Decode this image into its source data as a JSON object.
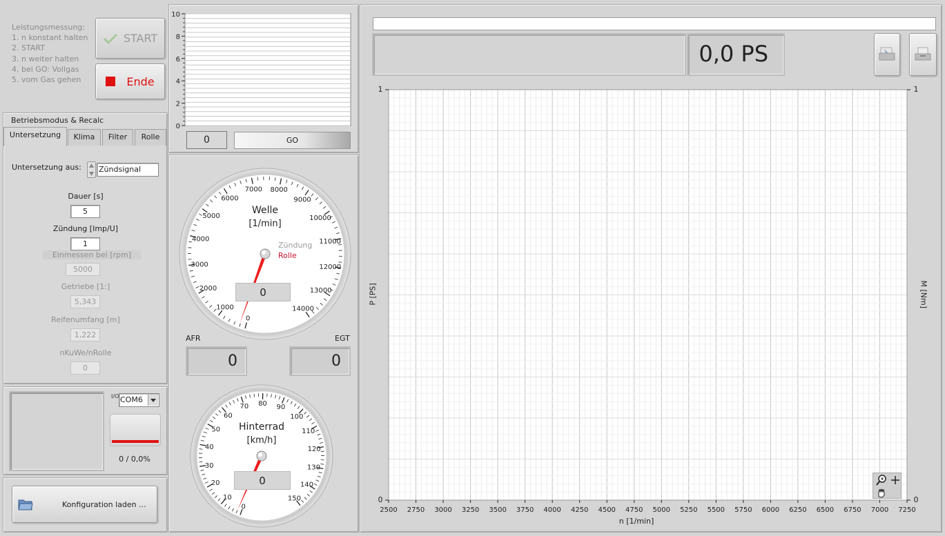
{
  "instructions": {
    "title": "Leistungsmessung:",
    "steps": [
      "1. n konstant halten",
      "2. START",
      "3. n weiter halten",
      "4. bei GO: Vollgas",
      "5. vom Gas gehen"
    ]
  },
  "buttons": {
    "start": "START",
    "ende": "Ende",
    "config": "Konfiguration laden ..."
  },
  "mini_chart": {
    "y_ticks": [
      "10",
      "8",
      "6",
      "4",
      "2",
      "0"
    ],
    "value": "0",
    "go_label": "GO"
  },
  "tabs_panel": {
    "title": "Betriebsmodus & Recalc",
    "tabs": [
      "Untersetzung",
      "Klima",
      "Filter",
      "Rolle"
    ],
    "active_tab": "Untersetzung",
    "untersetzung_label": "Untersetzung aus:",
    "untersetzung_value": "Zündsignal",
    "fields": [
      {
        "label": "Dauer [s]",
        "value": "5",
        "enabled": true
      },
      {
        "label": "Zündung [Imp/U]",
        "value": "1",
        "enabled": true
      },
      {
        "label": "Einmessen bei [rpm]",
        "value": "5000",
        "enabled": false
      },
      {
        "label": "Getriebe [1:]",
        "value": "5,343",
        "enabled": false
      },
      {
        "label": "Reifenumfang [m]",
        "value": "1,222",
        "enabled": false
      },
      {
        "label": "nKuWe/nRolle",
        "value": "0",
        "enabled": false
      }
    ]
  },
  "com": {
    "io_glyph": "I/O",
    "port": "COM6",
    "progress_text": "0 / 0,0%"
  },
  "gauge_welle": {
    "title_line1": "Welle",
    "title_line2": "[1/min]",
    "legend_zuendung": "Zündung",
    "legend_rolle": "Rolle",
    "value": "0",
    "ticks": [
      "0",
      "1000",
      "2000",
      "3000",
      "4000",
      "5000",
      "6000",
      "7000",
      "8000",
      "9000",
      "10000",
      "11000",
      "12000",
      "13000",
      "14000"
    ]
  },
  "afr": {
    "label": "AFR",
    "value": "0"
  },
  "egt": {
    "label": "EGT",
    "value": "0"
  },
  "gauge_hinterrad": {
    "title_line1": "Hinterrad",
    "title_line2": "[km/h]",
    "value": "0",
    "ticks": [
      "0",
      "10",
      "20",
      "30",
      "40",
      "50",
      "60",
      "70",
      "80",
      "90",
      "100",
      "110",
      "120",
      "130",
      "140",
      "150"
    ]
  },
  "power_display": {
    "value": "0,0 PS"
  },
  "main_chart": {
    "x_ticks": [
      "2500",
      "2750",
      "3000",
      "3250",
      "3500",
      "3750",
      "4000",
      "4250",
      "4500",
      "4750",
      "5000",
      "5250",
      "5500",
      "5750",
      "6000",
      "6250",
      "6500",
      "6750",
      "7000",
      "7250"
    ],
    "xlabel": "n [1/min]",
    "ylabel_left": "P [PS]",
    "ylabel_right": "M [Nm]",
    "y_left_top": "1",
    "y_left_bottom": "0",
    "y_right_top": "1",
    "y_right_bottom": "0"
  },
  "colors": {
    "accent_red": "#e01010",
    "needle": "#ee1c1c",
    "rolle_label": "#c8102e"
  }
}
